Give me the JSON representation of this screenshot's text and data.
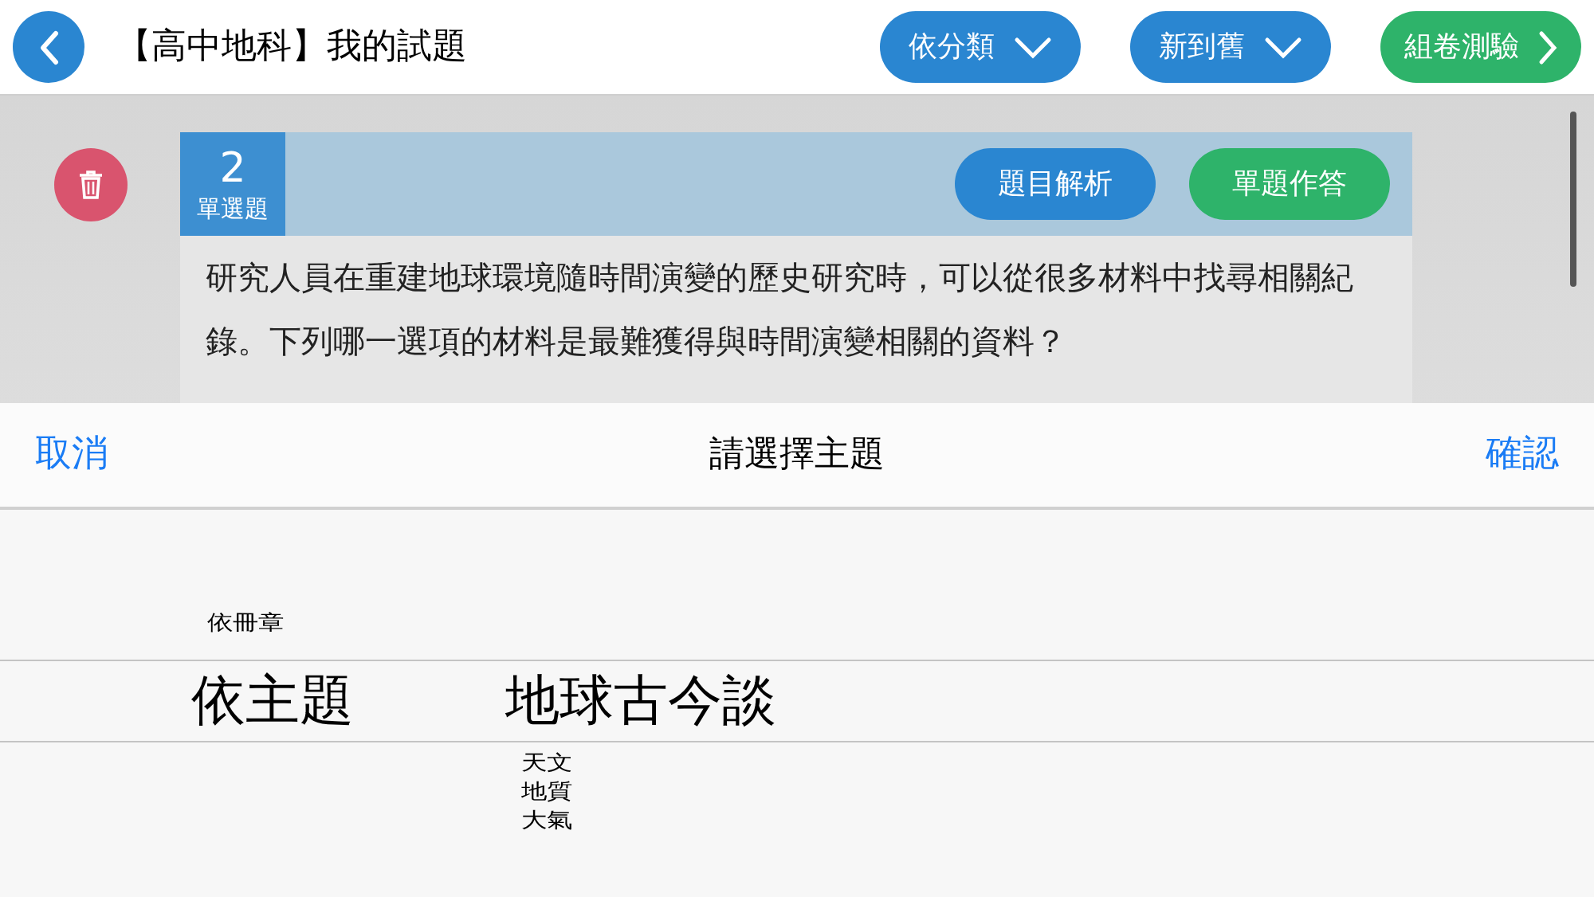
{
  "header": {
    "title": "【高中地科】我的試題",
    "buttons": [
      {
        "label": "依分類",
        "kind": "dropdown"
      },
      {
        "label": "新到舊",
        "kind": "dropdown"
      },
      {
        "label": "組卷測驗",
        "kind": "next"
      }
    ]
  },
  "questions": [
    {
      "number": "2",
      "type": "單選題",
      "buttons": [
        {
          "label": "題目解析",
          "kind": "analysis"
        },
        {
          "label": "單題作答",
          "kind": "answer"
        }
      ],
      "text": "研究人員在重建地球環境隨時間演變的歷史研究時，可以從很多材料中找尋相關紀錄。下列哪一選項的材料是最難獲得與時間演變相關的資料？"
    }
  ],
  "picker": {
    "cancel": "取消",
    "title": "請選擇主題",
    "confirm": "確認",
    "columns": [
      {
        "items": [
          {
            "label": "依冊章",
            "selected": false
          },
          {
            "label": "依主題",
            "selected": true
          }
        ]
      },
      {
        "items": [
          {
            "label": "地球古今談",
            "selected": true
          },
          {
            "label": "天文",
            "selected": false
          },
          {
            "label": "地質",
            "selected": false
          },
          {
            "label": "大氣",
            "selected": false
          }
        ]
      }
    ]
  }
}
